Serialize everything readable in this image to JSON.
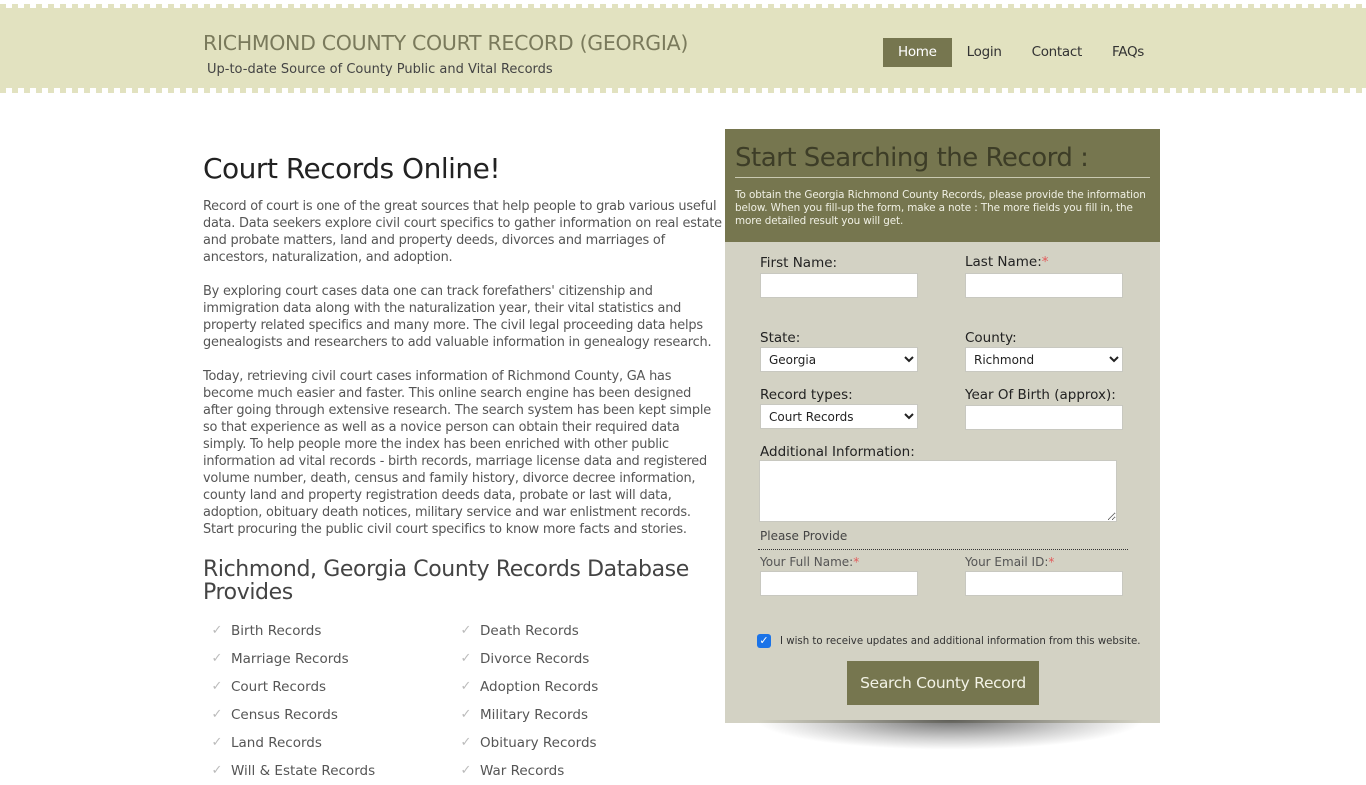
{
  "header": {
    "site_title": "RICHMOND COUNTY COURT RECORD (GEORGIA)",
    "tagline": "Up-to-date Source of  County Public and Vital Records",
    "nav": [
      {
        "label": "Home",
        "active": true
      },
      {
        "label": "Login",
        "active": false
      },
      {
        "label": "Contact",
        "active": false
      },
      {
        "label": "FAQs",
        "active": false
      }
    ]
  },
  "main": {
    "heading": "Court Records Online!",
    "paragraphs": [
      "Record of court is one of the great sources that help people to grab various useful data. Data seekers explore civil court specifics to gather information on real estate and probate matters, land and property deeds, divorces and marriages of ancestors, naturalization, and adoption.",
      "By exploring court cases data one can track forefathers' citizenship and immigration data along with the naturalization year, their vital statistics and property related specifics and many more. The civil legal proceeding data helps genealogists and researchers to add valuable information in genealogy research.",
      "Today, retrieving civil court cases information of Richmond County, GA has become much easier and faster. This online search engine has been designed after going through extensive research. The search system has been kept simple so that experience as well as a novice person can obtain their required data simply. To help people more the index has been enriched with other public information ad vital records - birth records, marriage license data and registered volume number, death, census and family history, divorce decree information, county land and property registration deeds data, probate or last will data, adoption, obituary death notices, military service and war enlistment records. Start procuring the public civil court specifics to know more facts and stories."
    ],
    "subheading": "Richmond, Georgia County Records Database Provides",
    "records": [
      "Birth Records",
      "Death Records",
      "Marriage Records",
      "Divorce Records",
      "Court Records",
      "Adoption Records",
      "Census Records",
      "Military Records",
      "Land Records",
      "Obituary Records",
      "Will & Estate Records",
      "War Records"
    ]
  },
  "form": {
    "title": "Start Searching the Record :",
    "intro": "To obtain the Georgia Richmond County Records, please provide the information below. When you fill-up the form, make a note : The more fields you fill in, the more detailed result you will get.",
    "first_name_label": "First Name:",
    "last_name_label": "Last Name:",
    "required_mark": "*",
    "state_label": "State:",
    "state_value": "Georgia",
    "county_label": "County:",
    "county_value": "Richmond",
    "record_types_label": "Record types:",
    "record_types_value": "Court Records",
    "yob_label": "Year Of Birth (approx):",
    "additional_label": "Additional Information:",
    "please_provide": "Please Provide",
    "full_name_label": "Your Full Name:",
    "email_label": "Your Email ID:",
    "optin_checked": true,
    "optin_label": "I wish to receive updates and additional information from this website.",
    "submit_label": "Search County Record"
  },
  "colors": {
    "header_band": "#e2e2c0",
    "accent": "#76764f",
    "panel_bg": "#d3d2c4",
    "required": "#e35a5a"
  }
}
